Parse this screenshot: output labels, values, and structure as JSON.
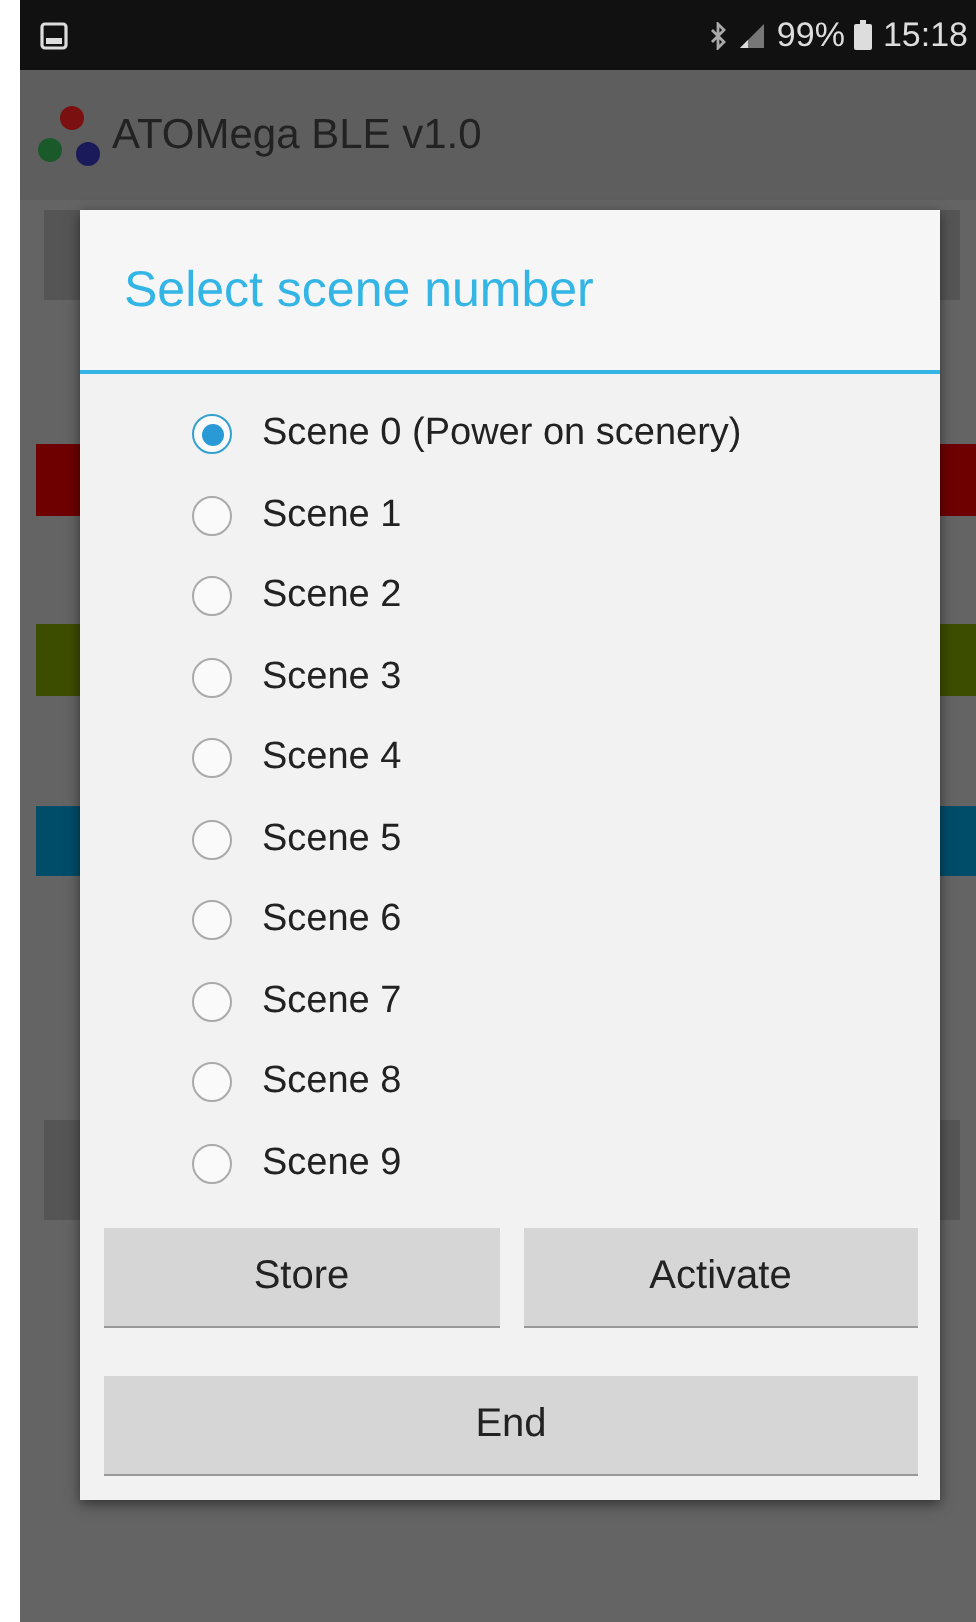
{
  "status_bar": {
    "battery": "99%",
    "time": "15:18"
  },
  "app_bar": {
    "title": "ATOMega BLE v1.0"
  },
  "background_bars": [
    {
      "color": "#555555"
    },
    {
      "color": "#6e0000"
    },
    {
      "color": "#3d4d00"
    },
    {
      "color": "#004d69"
    },
    {
      "color": "#555555"
    }
  ],
  "dialog": {
    "title": "Select scene number",
    "options": [
      {
        "label": "Scene 0 (Power on scenery)",
        "selected": true
      },
      {
        "label": "Scene 1",
        "selected": false
      },
      {
        "label": "Scene 2",
        "selected": false
      },
      {
        "label": "Scene 3",
        "selected": false
      },
      {
        "label": "Scene 4",
        "selected": false
      },
      {
        "label": "Scene 5",
        "selected": false
      },
      {
        "label": "Scene 6",
        "selected": false
      },
      {
        "label": "Scene 7",
        "selected": false
      },
      {
        "label": "Scene 8",
        "selected": false
      },
      {
        "label": "Scene 9",
        "selected": false
      }
    ],
    "buttons": [
      {
        "label": "Store"
      },
      {
        "label": "Activate"
      }
    ],
    "end_button": {
      "label": "End"
    }
  }
}
